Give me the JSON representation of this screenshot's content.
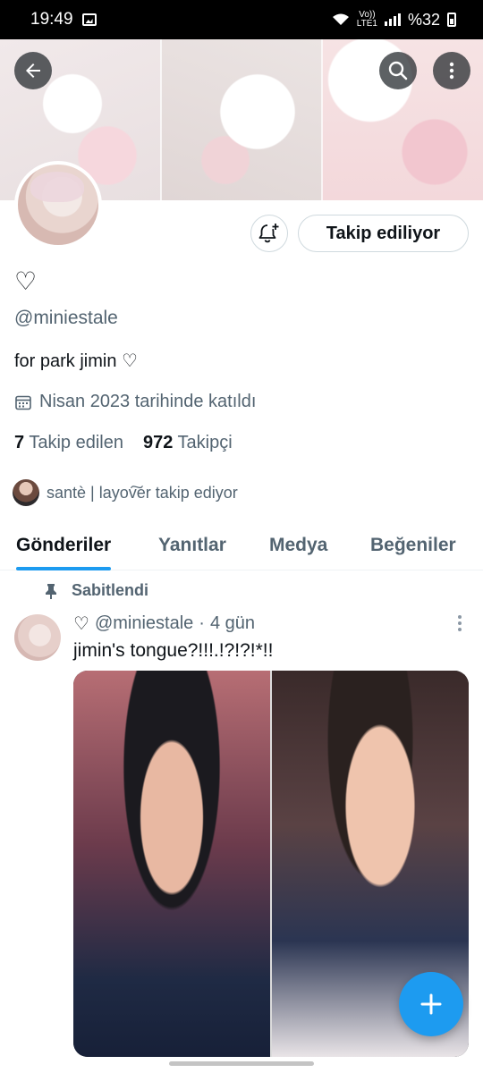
{
  "status_bar": {
    "time": "19:49",
    "network_top": "Vo))",
    "network_bottom": "LTE1",
    "battery": "%32"
  },
  "profile": {
    "name": "♡",
    "handle": "@miniestale",
    "bio": "for park jimin ♡",
    "joined": "Nisan 2023 tarihinde katıldı",
    "following_count": "7",
    "following_label": "Takip edilen",
    "followers_count": "972",
    "followers_label": "Takipçi",
    "followed_by": "santè | layov͠er takip ediyor",
    "follow_button": "Takip ediliyor"
  },
  "tabs": [
    {
      "label": "Gönderiler",
      "active": true
    },
    {
      "label": "Yanıtlar",
      "active": false
    },
    {
      "label": "Medya",
      "active": false
    },
    {
      "label": "Beğeniler",
      "active": false
    }
  ],
  "post": {
    "pinned_label": "Sabitlendi",
    "author_name": "♡",
    "author_handle": "@miniestale",
    "separator": "·",
    "time": "4 gün",
    "text": "jimin's tongue?!!!.!?!?!*!!"
  },
  "icons": {
    "back": "back-arrow-icon",
    "search": "search-icon",
    "more": "more-vertical-icon",
    "bell": "notification-bell-add-icon",
    "calendar": "calendar-icon",
    "pin": "pin-icon",
    "compose": "plus-icon"
  },
  "colors": {
    "accent": "#1d9bf0",
    "secondary_text": "#536471",
    "primary_text": "#0f1419"
  }
}
